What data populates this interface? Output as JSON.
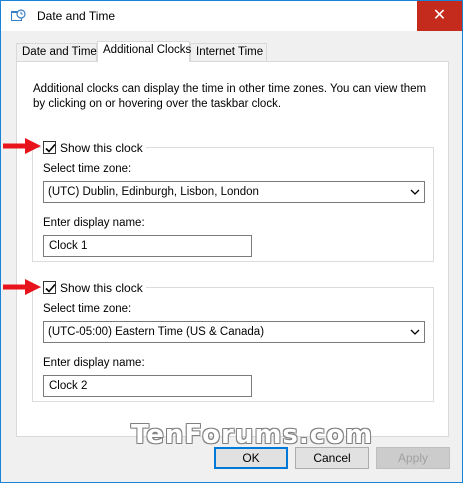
{
  "window": {
    "title": "Date and Time",
    "close_glyph": "✕"
  },
  "tabs": [
    {
      "label": "Date and Time",
      "active": false
    },
    {
      "label": "Additional Clocks",
      "active": true
    },
    {
      "label": "Internet Time",
      "active": false
    }
  ],
  "intro_text": "Additional clocks can display the time in other time zones. You can view them by clicking on or hovering over the taskbar clock.",
  "clocks": [
    {
      "show_label": "Show this clock",
      "checked": true,
      "timezone_label": "Select time zone:",
      "timezone_value": "(UTC) Dublin, Edinburgh, Lisbon, London",
      "name_label": "Enter display name:",
      "name_value": "Clock 1"
    },
    {
      "show_label": "Show this clock",
      "checked": true,
      "timezone_label": "Select time zone:",
      "timezone_value": "(UTC-05:00) Eastern Time (US & Canada)",
      "name_label": "Enter display name:",
      "name_value": "Clock 2"
    }
  ],
  "watermark": "TenForums.com",
  "buttons": {
    "ok": "OK",
    "cancel": "Cancel",
    "apply": "Apply"
  },
  "colors": {
    "accent": "#0078d7",
    "close_red": "#c42b1c",
    "arrow_red": "#e8141b"
  },
  "icons": {
    "app": "clock-icon",
    "close": "close-icon",
    "dropdown": "chevron-down-icon",
    "check": "checkmark-icon",
    "annotation": "red-arrow-icon"
  }
}
